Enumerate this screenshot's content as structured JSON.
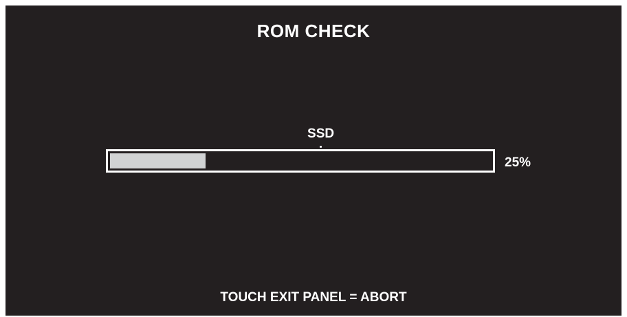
{
  "screen": {
    "title": "ROM CHECK",
    "status": {
      "label": "SSD",
      "separator": ":",
      "value": "- - -"
    },
    "progress": {
      "value": 0.25,
      "percent_text": "25%"
    },
    "footer": "TOUCH EXIT PANEL = ABORT"
  },
  "colors": {
    "background": "#231f20",
    "text": "#ffffff",
    "progress_border": "#ffffff",
    "progress_fill": "#d1d3d4"
  }
}
